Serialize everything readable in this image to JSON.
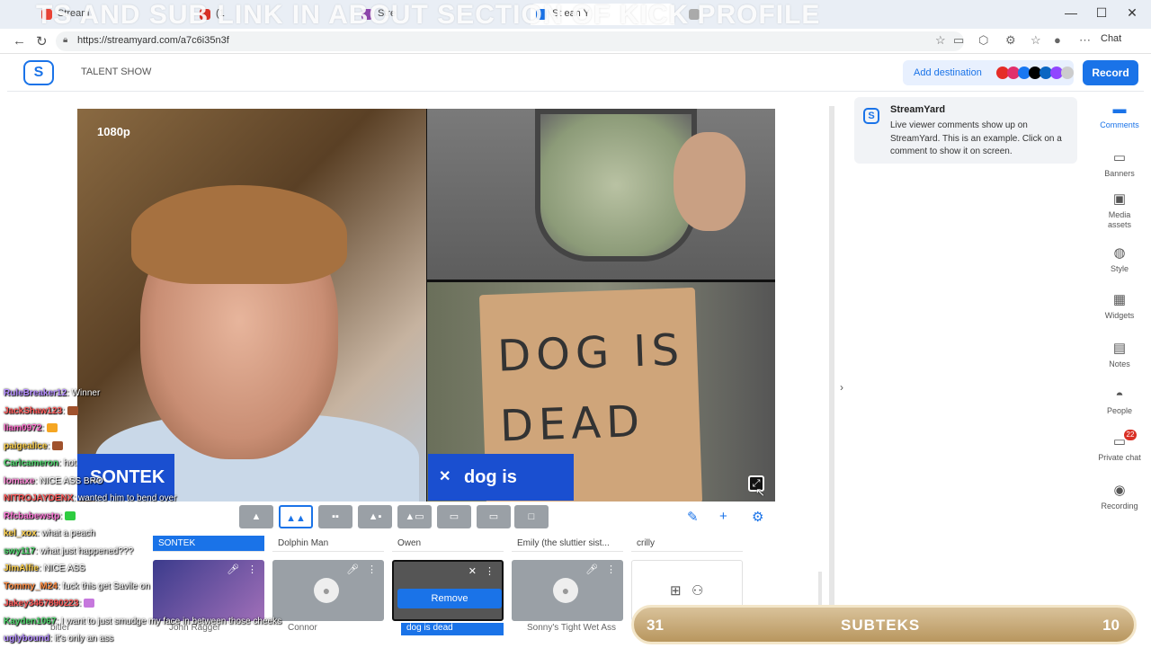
{
  "browser": {
    "tabs": [
      {
        "label": "Stream",
        "color": "#e94235"
      },
      {
        "label": "(1",
        "color": "#d93025"
      },
      {
        "label": "Stre",
        "color": "#8e44ad"
      },
      {
        "label": "St ean Y",
        "color": "#1a73e8",
        "active": true
      },
      {
        "label": "",
        "color": "#aaa"
      }
    ],
    "overlay_banner": "TS AND SUB LINK IN ABOUT SECTION OF KICK PROFILE",
    "url": "https://streamyard.com/a7c6i35n3f",
    "chat_label": "Chat",
    "window_controls": [
      "—",
      "☐",
      "✕"
    ]
  },
  "app": {
    "show_title": "TALENT SHOW",
    "add_destination": "Add destination",
    "record": "Record",
    "destination_colors": [
      "#e52d27",
      "#e1306c",
      "#1877f2",
      "#000000",
      "#0a66c2",
      "#9146ff",
      "#cccccc"
    ]
  },
  "stage": {
    "resolution": "1080p",
    "left_name": "SONTEK",
    "right_name": "dog is dead",
    "sign_text": "DOG IS DEAD"
  },
  "toolbar": {
    "edit_icon": "pencil-icon",
    "add_icon": "plus-icon",
    "settings_icon": "gear-icon"
  },
  "tray": {
    "labels": [
      "SONTEK",
      "Dolphin Man",
      "Owen",
      "Emily (the sluttier sist...",
      "crilly"
    ],
    "sub_labels": [
      "bitler",
      "John Ragger",
      "Connor",
      "dog is dead",
      "Sonny's Tight Wet Ass"
    ],
    "remove": "Remove"
  },
  "chat_overlay": [
    {
      "user": "RuleBreaker12",
      "msg": ": Winner",
      "color": "#b48cff"
    },
    {
      "user": "JackShaw123",
      "msg": ":",
      "color": "#ff5a5a"
    },
    {
      "user": "liam0972",
      "msg": ":",
      "color": "#ff6bcb"
    },
    {
      "user": "paigealice",
      "msg": ":",
      "color": "#ffd24d"
    },
    {
      "user": "Carlcameron",
      "msg": ": hot",
      "color": "#4dd46b"
    },
    {
      "user": "lomaxe",
      "msg": ": NICE ASS BRO",
      "color": "#ff8ad8"
    },
    {
      "user": "NITROJAYDENX",
      "msg": ": wanted him to bend over",
      "color": "#ff5a5a"
    },
    {
      "user": "Rfcbabewstp",
      "msg": ":",
      "color": "#ff7ad9"
    },
    {
      "user": "kel_xox",
      "msg": ": what a peach",
      "color": "#ffd24d"
    },
    {
      "user": "swy117",
      "msg": ": what just happened???",
      "color": "#4dd46b"
    },
    {
      "user": "JimAlfie",
      "msg": ": NICE ASS",
      "color": "#ffd24d"
    },
    {
      "user": "Tommy_M24",
      "msg": ": fuck this get Savile on",
      "color": "#ff8c42"
    },
    {
      "user": "Jakey3467890223",
      "msg": ":",
      "color": "#ff5a5a"
    },
    {
      "user": "Kayden1067",
      "msg": ": I want to just smudge my face in between those cheeks",
      "color": "#4dd46b"
    },
    {
      "user": "uglybound",
      "msg": ": it's only an ass",
      "color": "#b48cff"
    }
  ],
  "side_panel": {
    "title": "StreamYard",
    "body": "Live viewer comments show up on StreamYard. This is an example. Click on a comment to show it on screen."
  },
  "rail": [
    {
      "label": "Comments",
      "icon": "comments-icon",
      "glyph": "▬",
      "active": true
    },
    {
      "label": "Banners",
      "icon": "banners-icon",
      "glyph": "▭"
    },
    {
      "label": "Media assets",
      "icon": "media-icon",
      "glyph": "▣"
    },
    {
      "label": "Style",
      "icon": "palette-icon",
      "glyph": "◍"
    },
    {
      "label": "Widgets",
      "icon": "widgets-icon",
      "glyph": "▦"
    },
    {
      "label": "Notes",
      "icon": "notes-icon",
      "glyph": "▤"
    },
    {
      "label": "People",
      "icon": "people-icon",
      "glyph": "◓"
    },
    {
      "label": "Private chat",
      "icon": "private-chat-icon",
      "glyph": "▭",
      "badge": "22"
    },
    {
      "label": "Recording",
      "icon": "recording-icon",
      "glyph": "◉"
    }
  ],
  "sub_goal": {
    "left": "31",
    "name": "SUBTEKS",
    "right": "10"
  }
}
